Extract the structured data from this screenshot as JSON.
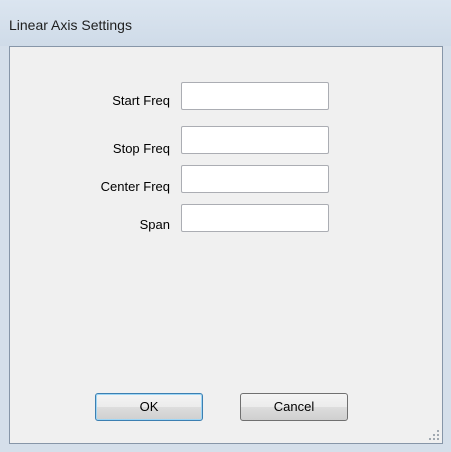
{
  "window": {
    "title": "Linear Axis Settings"
  },
  "form": {
    "fields": [
      {
        "label": "Start Freq",
        "value": ""
      },
      {
        "label": "Stop Freq",
        "value": ""
      },
      {
        "label": "Center Freq",
        "value": ""
      },
      {
        "label": "Span",
        "value": ""
      }
    ]
  },
  "buttons": {
    "ok_label": "OK",
    "cancel_label": "Cancel"
  },
  "icons": {
    "resize_grip": "resize-grip-icon"
  },
  "colors": {
    "frame": "#d5dfea",
    "client": "#f0f0f0",
    "default_button_border": "#3c7fb1"
  }
}
